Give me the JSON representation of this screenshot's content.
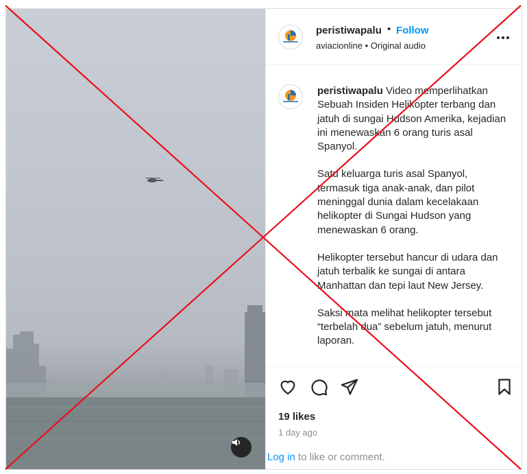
{
  "post": {
    "username": "peristiwapalu",
    "separator": "•",
    "follow_label": "Follow",
    "audio": {
      "artist": "aviacionline",
      "separator": "•",
      "track": "Original audio"
    },
    "avatar_text": "Peristiwapalu",
    "caption": {
      "username": "peristiwapalu",
      "paragraphs": [
        "Video memperlihatkan Sebuah Insiden Helikopter terbang dan jatuh di sungai Hudson Amerika, kejadian ini menewaskan 6 orang turis asal Spanyol.",
        "Satu keluarga turis asal Spanyol, termasuk tiga anak-anak, dan pilot meninggal dunia dalam kecelakaan helikopter di Sungai Hudson yang menewaskan 6 orang.",
        "Helikopter tersebut hancur di udara dan jatuh terbalik ke sungai di antara Manhattan dan tepi laut New Jersey.",
        "Saksi mata melihat helikopter tersebut “terbelah dua” sebelum jatuh, menurut laporan."
      ]
    },
    "likes": "19 likes",
    "time": "1 day ago",
    "login": {
      "link": "Log in",
      "rest": " to like or comment."
    }
  },
  "icons": {
    "like": "heart-icon",
    "comment": "comment-icon",
    "share": "paper-plane-icon",
    "save": "bookmark-icon",
    "mute": "speaker-icon",
    "more": "more-options-icon"
  },
  "colors": {
    "accent": "#0095f6",
    "cross": "#e8101a",
    "muted": "#8e8e8e"
  }
}
